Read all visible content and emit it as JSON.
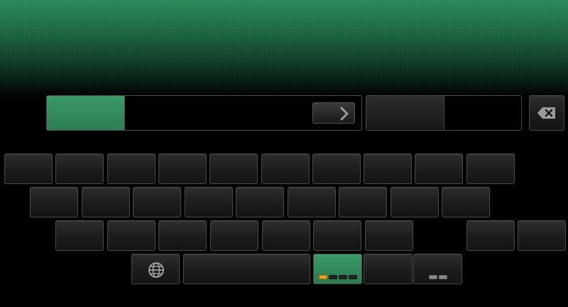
{
  "keyboard": {
    "rows": [
      {
        "count": 10
      },
      {
        "count": 9
      },
      {
        "count": 9
      }
    ]
  },
  "colors": {
    "accent": "#2e8b57",
    "indicator_active": "#f0a020",
    "key_border": "#4a4a4a"
  },
  "icons": {
    "next": "chevron-right-icon",
    "backspace": "backspace-icon",
    "language": "globe-icon"
  },
  "layout_indicator": {
    "total": 4,
    "active": 1
  }
}
